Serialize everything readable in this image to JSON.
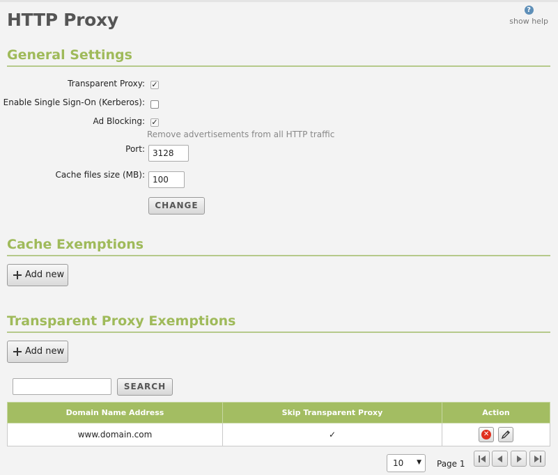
{
  "page": {
    "title": "HTTP Proxy",
    "help_label": "show help",
    "help_glyph": "?"
  },
  "general": {
    "title": "General Settings",
    "transparent_proxy": {
      "label": "Transparent Proxy:",
      "checked": true
    },
    "sso": {
      "label": "Enable Single Sign-On (Kerberos):",
      "checked": false
    },
    "ad_blocking": {
      "label": "Ad Blocking:",
      "checked": true,
      "hint": "Remove advertisements from all HTTP traffic"
    },
    "port": {
      "label": "Port:",
      "value": "3128"
    },
    "cache_size": {
      "label": "Cache files size (MB):",
      "value": "100"
    },
    "change_label": "CHANGE"
  },
  "cache_exemptions": {
    "title": "Cache Exemptions",
    "add_label": "Add new"
  },
  "proxy_exemptions": {
    "title": "Transparent Proxy Exemptions",
    "add_label": "Add new",
    "search_value": "",
    "search_label": "SEARCH",
    "columns": [
      "Domain Name Address",
      "Skip Transparent Proxy",
      "Action"
    ],
    "rows": [
      {
        "domain": "www.domain.com",
        "skip": true
      }
    ],
    "page_size": "10",
    "page_label": "Page 1"
  },
  "colors": {
    "accent_green": "#9fba5a",
    "header_green": "#a3bd62",
    "delete_red": "#e0301e"
  },
  "icons": {
    "help": "help-icon",
    "check": "check-icon",
    "plus": "plus-icon",
    "delete": "delete-icon",
    "edit": "pencil-icon",
    "first": "first-page-icon",
    "prev": "prev-page-icon",
    "next": "next-page-icon",
    "last": "last-page-icon"
  }
}
